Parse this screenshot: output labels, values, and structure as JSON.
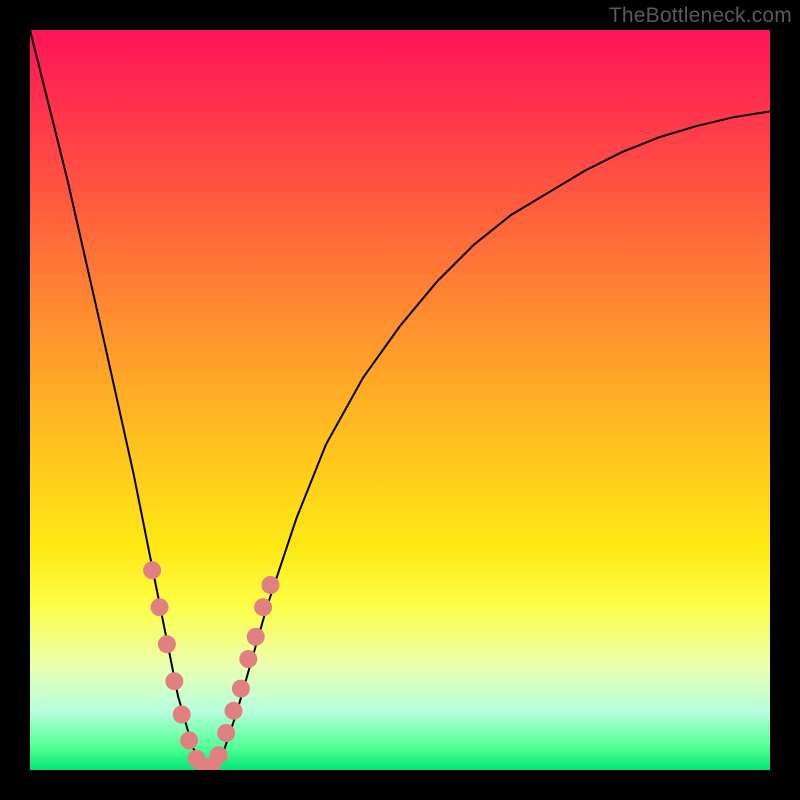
{
  "watermark": "TheBottleneck.com",
  "chart_data": {
    "type": "line",
    "title": "",
    "xlabel": "",
    "ylabel": "",
    "xlim": [
      0,
      100
    ],
    "ylim": [
      0,
      100
    ],
    "grid": false,
    "legend": false,
    "x": [
      0,
      5,
      10,
      14,
      16,
      18,
      20,
      22,
      24,
      26,
      28,
      32,
      36,
      40,
      45,
      50,
      55,
      60,
      65,
      70,
      75,
      80,
      85,
      90,
      95,
      100
    ],
    "series": [
      {
        "name": "bottleneck-curve",
        "color": "#000000",
        "values": [
          100,
          80,
          58,
          40,
          30,
          20,
          10,
          3,
          0,
          2,
          8,
          22,
          34,
          44,
          53,
          60,
          66,
          71,
          75,
          78,
          81,
          83.5,
          85.5,
          87,
          88.2,
          89
        ]
      }
    ],
    "markers": {
      "name": "highlight-dots",
      "color": "#e08080",
      "points": [
        {
          "x": 16.5,
          "y": 27
        },
        {
          "x": 17.5,
          "y": 22
        },
        {
          "x": 18.5,
          "y": 17
        },
        {
          "x": 19.5,
          "y": 12
        },
        {
          "x": 20.5,
          "y": 7.5
        },
        {
          "x": 21.5,
          "y": 4
        },
        {
          "x": 22.5,
          "y": 1.5
        },
        {
          "x": 23.5,
          "y": 0.3
        },
        {
          "x": 24.5,
          "y": 0.5
        },
        {
          "x": 25.5,
          "y": 2
        },
        {
          "x": 26.5,
          "y": 5
        },
        {
          "x": 27.5,
          "y": 8
        },
        {
          "x": 28.5,
          "y": 11
        },
        {
          "x": 29.5,
          "y": 15
        },
        {
          "x": 30.5,
          "y": 18
        },
        {
          "x": 31.5,
          "y": 22
        },
        {
          "x": 32.5,
          "y": 25
        }
      ]
    }
  }
}
